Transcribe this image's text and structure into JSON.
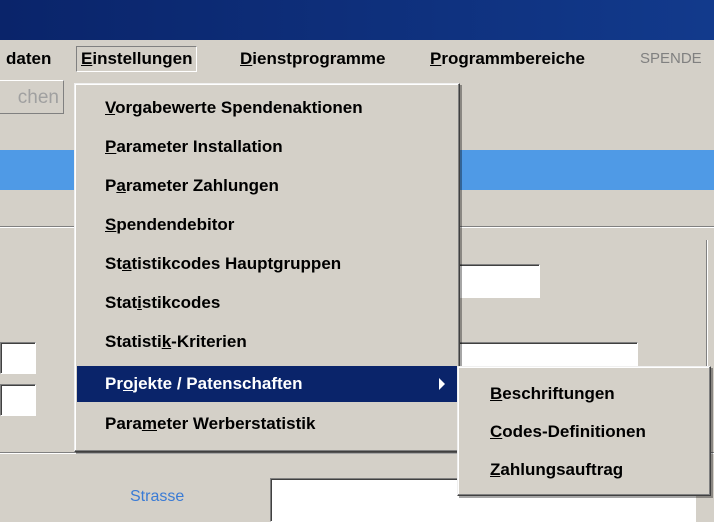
{
  "menubar": {
    "items": [
      {
        "pre": "daten",
        "u": "",
        "post": ""
      },
      {
        "pre": "",
        "u": "E",
        "post": "instellungen"
      },
      {
        "pre": "",
        "u": "D",
        "post": "ienstprogramme"
      },
      {
        "pre": "",
        "u": "P",
        "post": "rogrammbereiche"
      },
      {
        "pre": "SPENDE",
        "u": "",
        "post": ""
      }
    ]
  },
  "toolbar": {
    "button_label": "chen"
  },
  "form": {
    "strasse_label": "Strasse"
  },
  "dropdown": {
    "items": [
      {
        "pre": "",
        "u": "V",
        "post": "orgabewerte Spendenaktionen"
      },
      {
        "pre": "",
        "u": "P",
        "post": "arameter Installation"
      },
      {
        "pre": "P",
        "u": "a",
        "post": "rameter Zahlungen"
      },
      {
        "pre": "",
        "u": "S",
        "post": "pendendebitor"
      },
      {
        "pre": "St",
        "u": "a",
        "post": "tistikcodes Hauptgruppen"
      },
      {
        "pre": "Stat",
        "u": "i",
        "post": "stikcodes"
      },
      {
        "pre": "Statisti",
        "u": "k",
        "post": "-Kriterien"
      },
      {
        "pre": "Pr",
        "u": "o",
        "post": "jekte / Patenschaften"
      },
      {
        "pre": "Para",
        "u": "m",
        "post": "eter Werberstatistik"
      }
    ]
  },
  "submenu": {
    "items": [
      {
        "pre": "",
        "u": "B",
        "post": "eschriftungen"
      },
      {
        "pre": "",
        "u": "C",
        "post": "odes-Definitionen"
      },
      {
        "pre": "",
        "u": "Z",
        "post": "ahlungsauftrag"
      }
    ]
  }
}
